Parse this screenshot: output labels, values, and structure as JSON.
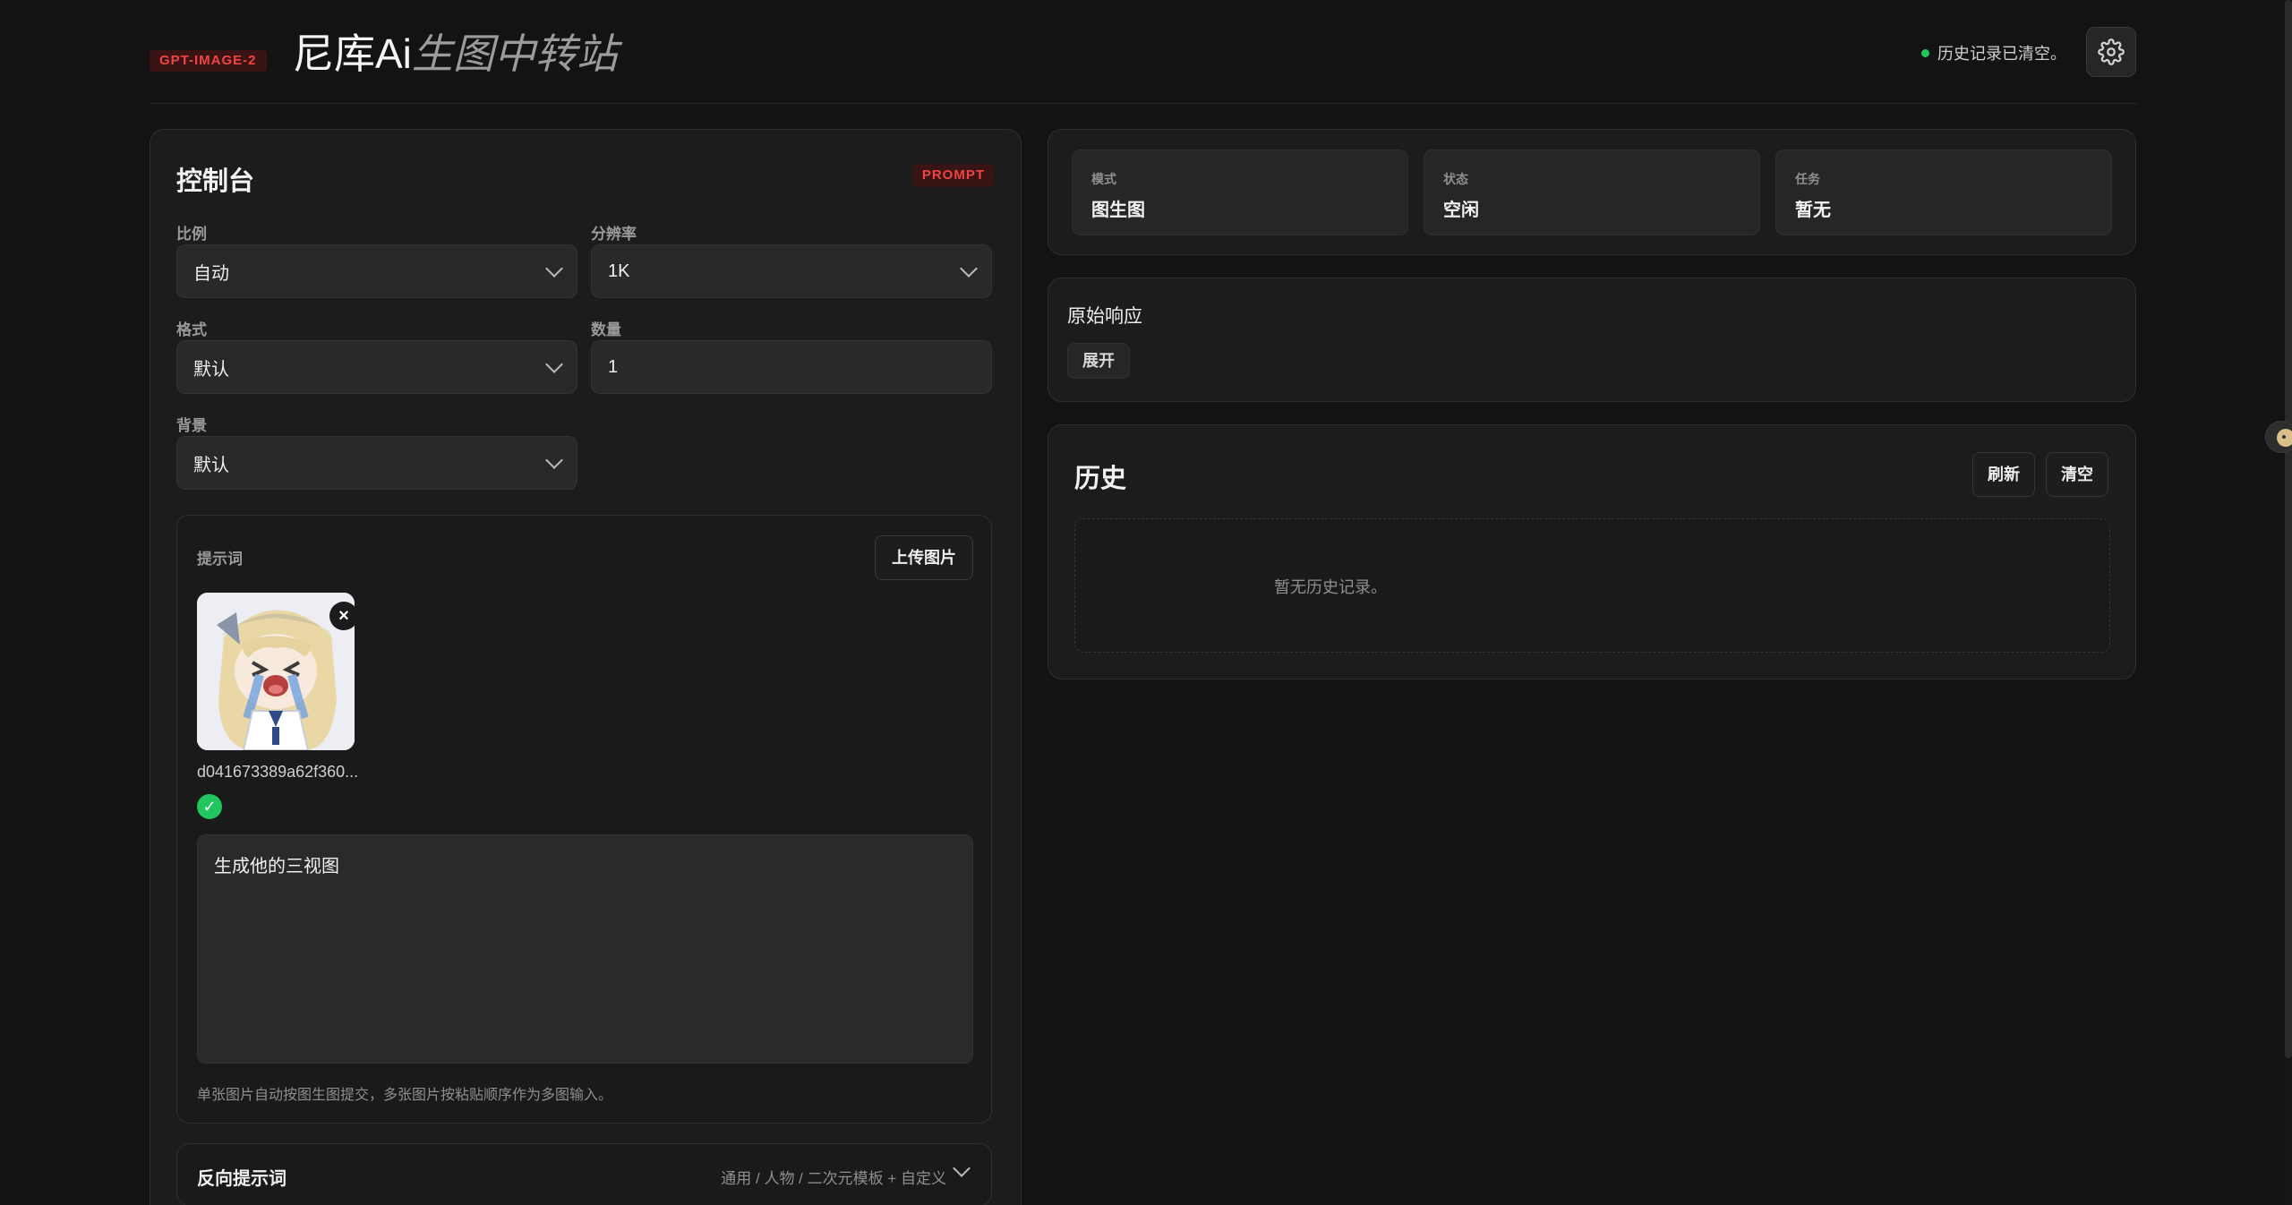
{
  "header": {
    "model_badge": "GPT-IMAGE-2",
    "title_main": "尼库Ai",
    "title_accent": "生图中转站",
    "status_note": "历史记录已清空。",
    "status_dot_color": "#22c55e",
    "settings_icon": "gear-icon"
  },
  "console": {
    "title": "控制台",
    "badge": "PROMPT",
    "fields": {
      "ratio": {
        "label": "比例",
        "value": "自动"
      },
      "resolution": {
        "label": "分辨率",
        "value": "1K"
      },
      "format": {
        "label": "格式",
        "value": "默认"
      },
      "quantity": {
        "label": "数量",
        "value": "1"
      },
      "background": {
        "label": "背景",
        "value": "默认"
      }
    },
    "prompt": {
      "label": "提示词",
      "upload_label": "上传图片",
      "image_filename": "d041673389a62f360...",
      "image_remove": "×",
      "image_status": "✓",
      "text": "生成他的三视图",
      "helper": "单张图片自动按图生图提交，多张图片按粘贴顺序作为多图输入。"
    },
    "negative": {
      "title": "反向提示词",
      "meta": "通用 / 人物 / 二次元模板 + 自定义"
    }
  },
  "status": {
    "mode": {
      "label": "模式",
      "value": "图生图"
    },
    "state": {
      "label": "状态",
      "value": "空闲"
    },
    "task": {
      "label": "任务",
      "value": "暂无"
    }
  },
  "raw": {
    "title": "原始响应",
    "expand_label": "展开"
  },
  "history": {
    "title": "历史",
    "refresh_label": "刷新",
    "clear_label": "清空",
    "empty_text": "暂无历史记录。"
  },
  "colors": {
    "accent_red": "#ef4444",
    "success_green": "#22c55e",
    "background": "#131313",
    "panel": "#1c1c1c"
  }
}
